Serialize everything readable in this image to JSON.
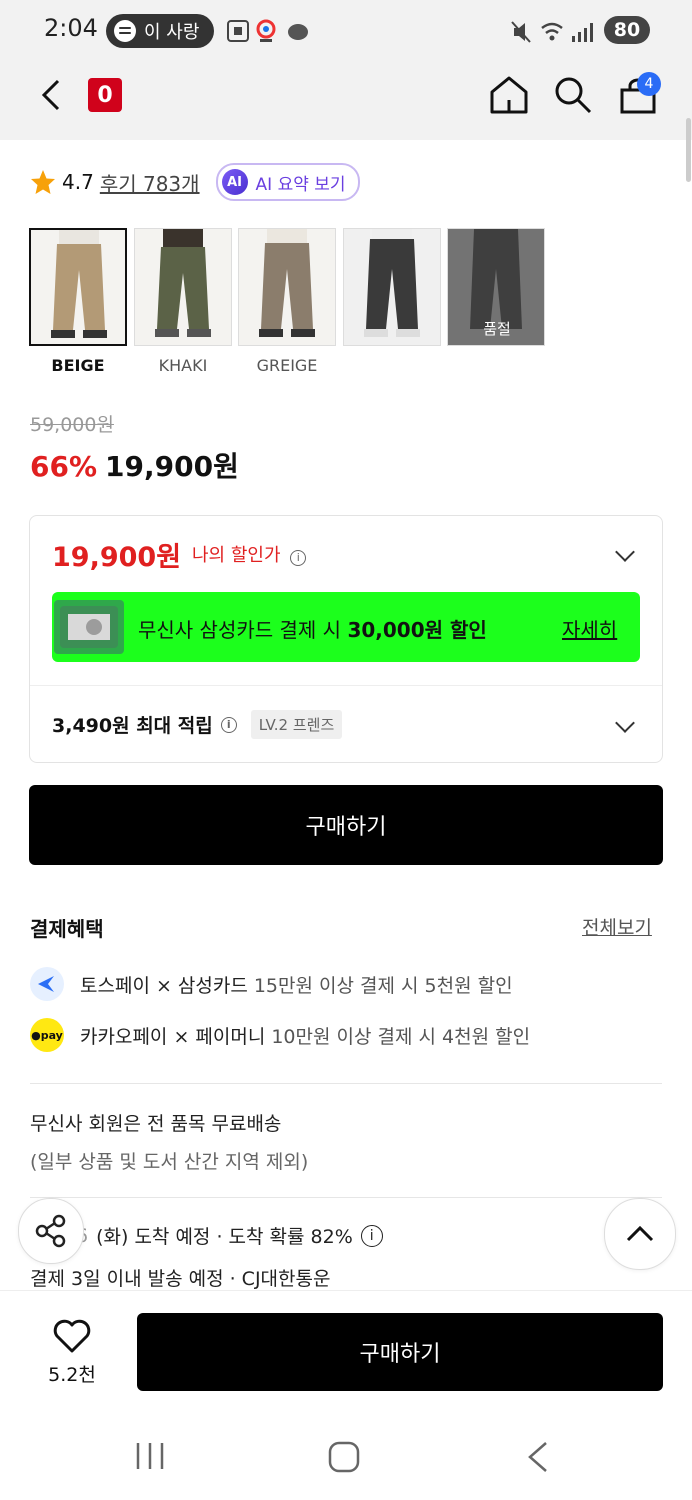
{
  "status_bar": {
    "time": "2:04",
    "music_label": "이 사랑",
    "battery": "80",
    "icons": [
      "spotify-icon",
      "screenshot-icon",
      "location-icon",
      "thread-icon",
      "mute-icon",
      "wifi-icon",
      "signal-icon",
      "battery-icon"
    ]
  },
  "header": {
    "brand_logo_text": "0",
    "cart_count": "4",
    "icons": [
      "back-arrow-icon",
      "home-icon",
      "search-icon",
      "cart-icon"
    ]
  },
  "rating": {
    "score": "4.7",
    "reviews_link": "후기 783개",
    "ai_badge": "AI",
    "ai_summary": "AI 요약 보기"
  },
  "colors": {
    "items": [
      {
        "name": "BEIGE",
        "selected": true,
        "sold_out": false
      },
      {
        "name": "KHAKI",
        "selected": false,
        "sold_out": false
      },
      {
        "name": "GREIGE",
        "selected": false,
        "sold_out": false
      },
      {
        "name": "",
        "selected": false,
        "sold_out": false
      },
      {
        "name": "",
        "selected": false,
        "sold_out": true
      }
    ],
    "sold_out_label": "품절"
  },
  "price": {
    "original": "59,000원",
    "discount_rate": "66%",
    "sale": "19,900원"
  },
  "my_price": {
    "amount": "19,900원",
    "label": "나의 할인가",
    "banner_text_prefix": "무신사 삼성카드 결제 시 ",
    "banner_text_bold": "30,000원 할인",
    "banner_link": "자세히",
    "banner_color": "#1cff1c",
    "points_text": "3,490원 최대 적립",
    "level_badge": "LV.2 프렌즈"
  },
  "buy_button": "구매하기",
  "payment_benefits": {
    "title": "결제혜택",
    "see_all": "전체보기",
    "items": [
      {
        "main": "토스페이 × 삼성카드",
        "detail": "15만원 이상 결제 시 5천원 할인"
      },
      {
        "main": "카카오페이 × 페이머니",
        "detail": "10만원 이상 결제 시 4천원 할인"
      }
    ],
    "kakao_icon_text": "●pay"
  },
  "shipping": {
    "line1": "무신사 회원은 전 품목 무료배송",
    "line2": "(일부 상품 및 도서 산간 지역 제외)",
    "arrival_prefix": "6",
    "arrival": "(화) 도착 예정 · 도착 확률 82%",
    "dispatch": "결제 3일 이내 발송 예정 · CJ대한통운"
  },
  "bottom": {
    "likes": "5.2천",
    "buy": "구매하기"
  }
}
